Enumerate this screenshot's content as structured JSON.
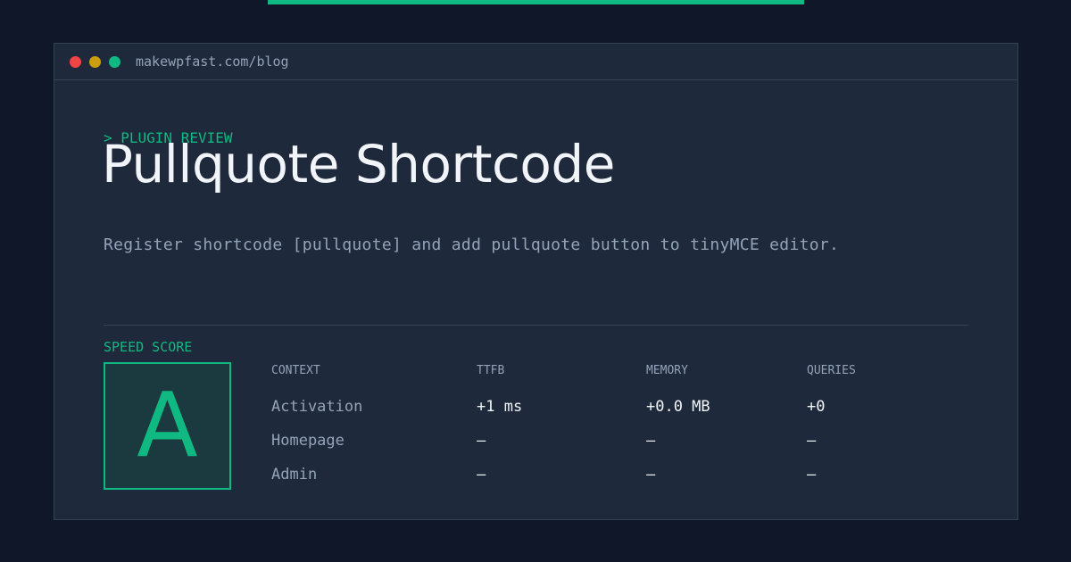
{
  "window": {
    "url": "makewpfast.com/blog"
  },
  "header": {
    "eyebrow": "> PLUGIN REVIEW",
    "title": "Pullquote Shortcode",
    "description": "Register shortcode [pullquote] and add pullquote button to tinyMCE editor."
  },
  "score": {
    "label": "SPEED SCORE",
    "grade": "A"
  },
  "table": {
    "columns": [
      "CONTEXT",
      "TTFB",
      "MEMORY",
      "QUERIES"
    ],
    "rows": [
      [
        "Activation",
        "+1 ms",
        "+0.0 MB",
        "+0"
      ],
      [
        "Homepage",
        "—",
        "—",
        "—"
      ],
      [
        "Admin",
        "—",
        "—",
        "—"
      ]
    ]
  },
  "colors": {
    "accent": "#10b981",
    "background": "#0f1729",
    "panel": "#1e293b",
    "muted_text": "#94a3b8",
    "bright_text": "#f1f5f9",
    "dot_red": "#ef4444",
    "dot_yellow": "#eab308",
    "dot_green": "#10b981"
  }
}
